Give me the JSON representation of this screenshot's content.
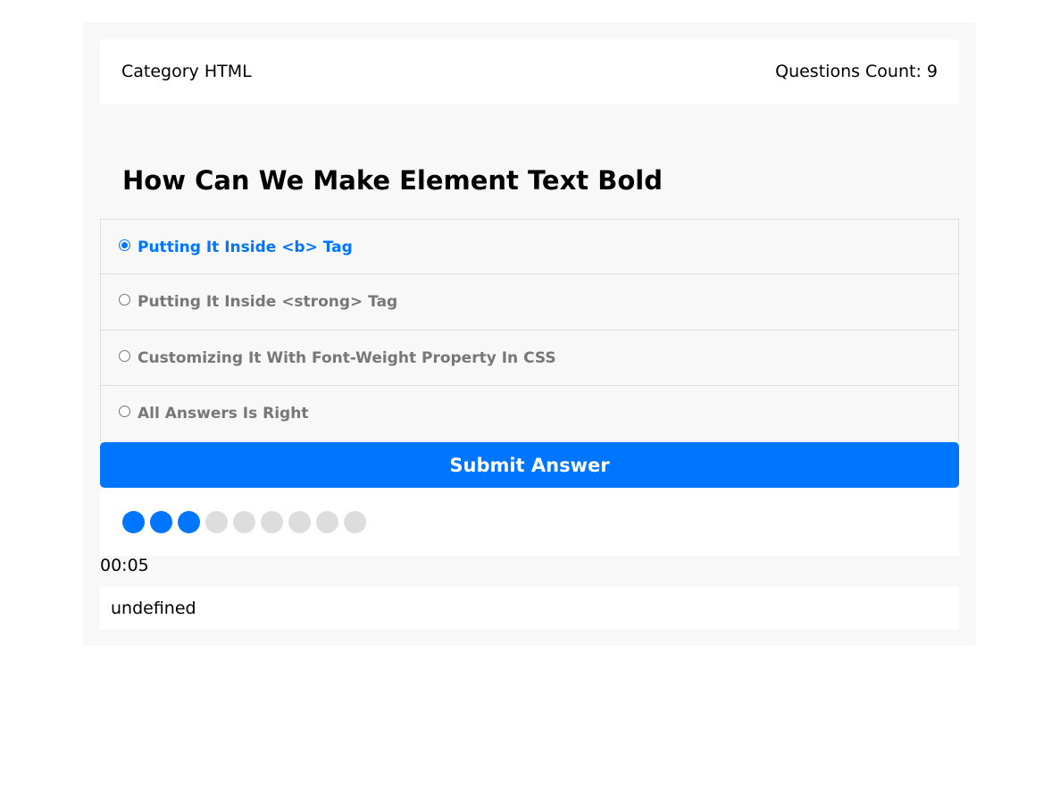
{
  "quiz_info": {
    "category": "Category HTML",
    "questions_count": "Questions Count: 9"
  },
  "question": {
    "title": "How Can We Make Element Text Bold",
    "answers": [
      {
        "label": "Putting It Inside <b> Tag",
        "checked": true
      },
      {
        "label": "Putting It Inside <strong> Tag",
        "checked": false
      },
      {
        "label": "Customizing It With Font-Weight Property In CSS",
        "checked": false
      },
      {
        "label": "All Answers Is Right",
        "checked": false
      }
    ]
  },
  "submit": {
    "label": "Submit Answer"
  },
  "bullets": {
    "total": 9,
    "answered": 3
  },
  "countdown": "00:05",
  "results": "undefined",
  "colors": {
    "accent": "#0075ff",
    "bullet_inactive": "#dddddd",
    "panel_background": "#f8f8f8"
  }
}
